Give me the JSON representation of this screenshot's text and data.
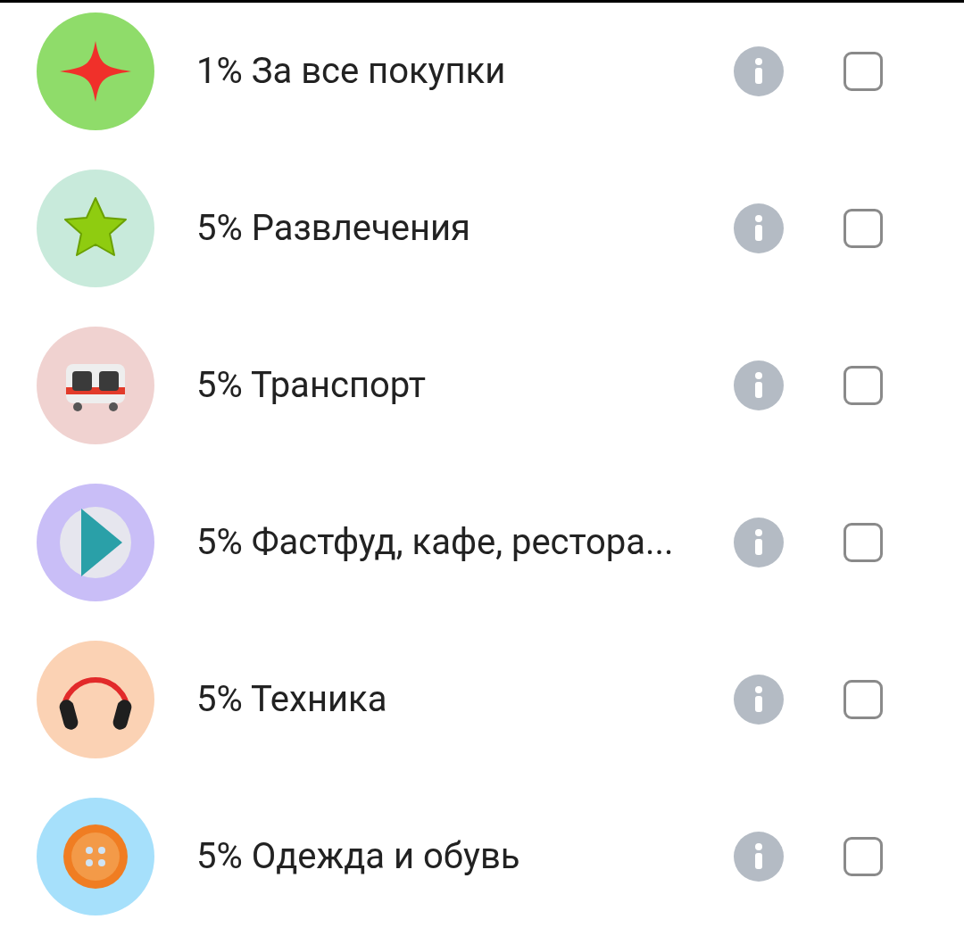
{
  "categories": [
    {
      "kind": "sparkle",
      "color": "#8fdc6a",
      "label": "1% За все покупки",
      "checked": false
    },
    {
      "kind": "star",
      "color": "#c8eadb",
      "label": "5% Развлечения",
      "checked": false
    },
    {
      "kind": "train",
      "color": "#f0d2d0",
      "label": "5% Транспорт",
      "checked": false
    },
    {
      "kind": "play",
      "color": "#c9bef7",
      "label": "5% Фастфуд, кафе, рестора...",
      "checked": false
    },
    {
      "kind": "headphones",
      "color": "#fbd2b4",
      "label": "5% Техника",
      "checked": false
    },
    {
      "kind": "button",
      "color": "#a6e0fb",
      "label": "5% Одежда и обувь",
      "checked": false
    }
  ]
}
